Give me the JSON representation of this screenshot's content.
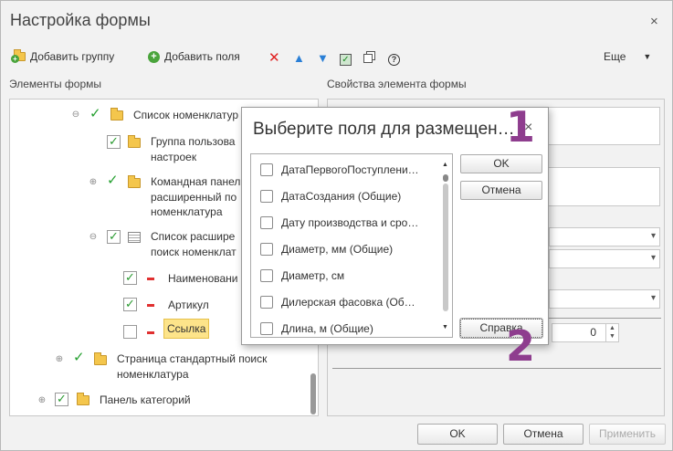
{
  "window": {
    "title": "Настройка формы",
    "close_icon": "×"
  },
  "toolbar": {
    "add_group": "Добавить группу",
    "add_fields": "Добавить поля",
    "more": "Еще",
    "icons": [
      "delete-icon",
      "move-up-icon",
      "move-down-icon",
      "check-all-icon",
      "copy-icon",
      "help-icon"
    ]
  },
  "left": {
    "header": "Элементы формы",
    "tree": [
      {
        "label": "Список номенклатур",
        "checked": true
      },
      {
        "label": "Группа пользова",
        "label2": "настроек",
        "checked": true
      },
      {
        "label": "Командная панел",
        "label2": "расширенный по",
        "label3": "номенклатура",
        "checked": true
      },
      {
        "label": "Список расшире",
        "label2": "поиск номенклат",
        "checked": true
      },
      {
        "label": "Наименовани",
        "checked": true
      },
      {
        "label": "Артикул",
        "checked": true
      },
      {
        "label": "Ссылка",
        "checked": false,
        "selected": true
      },
      {
        "label": "Страница стандартный поиск",
        "label2": "номенклатура",
        "checked": true
      },
      {
        "label": "Панель категорий",
        "checked": true
      }
    ]
  },
  "right": {
    "header": "Свойства элемента формы",
    "spin_value": "0"
  },
  "dialog": {
    "title": "Выберите поля для размещен…",
    "close_icon": "×",
    "fields": [
      "ДатаПервогоПоступлени…",
      "ДатаСоздания (Общие)",
      "Дату производства и сро…",
      "Диаметр, мм (Общие)",
      "Диаметр, см",
      "Дилерская фасовка (Об…",
      "Длина, м (Общие)"
    ],
    "ok": "OK",
    "cancel": "Отмена",
    "help": "Справка"
  },
  "annotations": {
    "one": "1",
    "two": "2"
  },
  "footer": {
    "ok": "OK",
    "cancel": "Отмена",
    "apply": "Применить"
  },
  "colors": {
    "accent_green": "#25a030",
    "folder": "#f4c64c",
    "annotation": "#8e3d8e",
    "selection": "#fde48a"
  }
}
